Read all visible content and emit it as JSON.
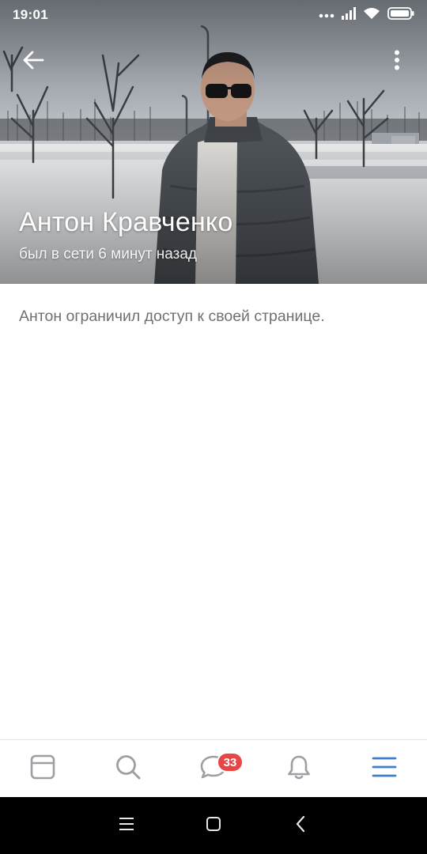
{
  "status_bar": {
    "time": "19:01",
    "icons": [
      "more-dots-icon",
      "signal-icon",
      "wifi-icon",
      "battery-icon"
    ]
  },
  "toolbar": {
    "back_icon": "arrow-left-icon",
    "menu_icon": "more-vertical-icon"
  },
  "profile": {
    "name": "Антон Кравченко",
    "last_seen": "был в сети 6 минут назад",
    "photo": "cover-photo"
  },
  "content": {
    "restriction_message": "Антон ограничил доступ к своей странице."
  },
  "tab_bar": {
    "tabs": [
      {
        "icon": "newsfeed-icon",
        "active": false
      },
      {
        "icon": "search-icon",
        "active": false
      },
      {
        "icon": "messages-icon",
        "active": false,
        "badge": "33"
      },
      {
        "icon": "bell-icon",
        "active": false
      },
      {
        "icon": "menu-icon",
        "active": true
      }
    ]
  },
  "nav_bar": {
    "buttons": [
      "recent-apps-icon",
      "home-icon",
      "back-icon"
    ]
  },
  "colors": {
    "accent": "#3f7fc9",
    "icon_inactive": "#9c9fa3",
    "badge": "#e64646",
    "text_secondary": "#6d6f72"
  }
}
